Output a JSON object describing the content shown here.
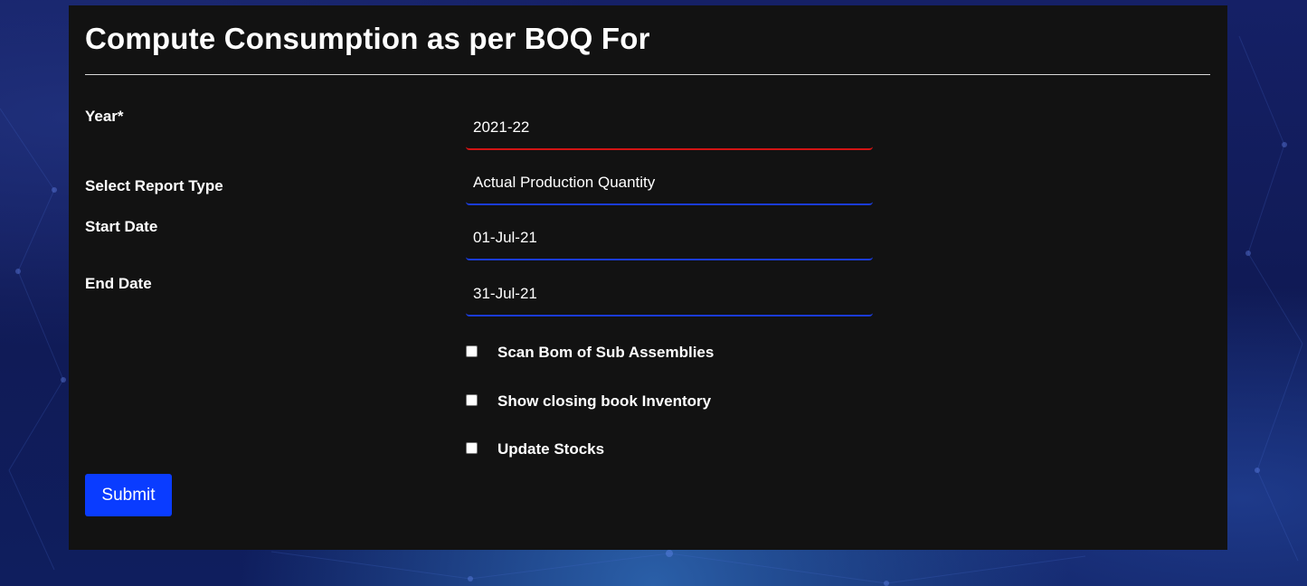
{
  "header": {
    "title": "Compute Consumption as per BOQ For"
  },
  "form": {
    "year": {
      "label": "Year*",
      "value": "2021-22"
    },
    "report_type": {
      "label": "Select Report Type",
      "value": "Actual Production Quantity"
    },
    "start_date": {
      "label": "Start Date",
      "value": "01-Jul-21"
    },
    "end_date": {
      "label": "End Date",
      "value": "31-Jul-21"
    },
    "options": [
      {
        "label": "Scan Bom of Sub Assemblies",
        "checked": false
      },
      {
        "label": "Show closing book Inventory",
        "checked": false
      },
      {
        "label": "Update Stocks",
        "checked": false
      }
    ],
    "submit_label": "Submit"
  },
  "colors": {
    "panel_bg": "#121212",
    "accent_blue": "#0a3cff",
    "field_underline": "#1a3bd6",
    "invalid_underline": "#d21414"
  }
}
